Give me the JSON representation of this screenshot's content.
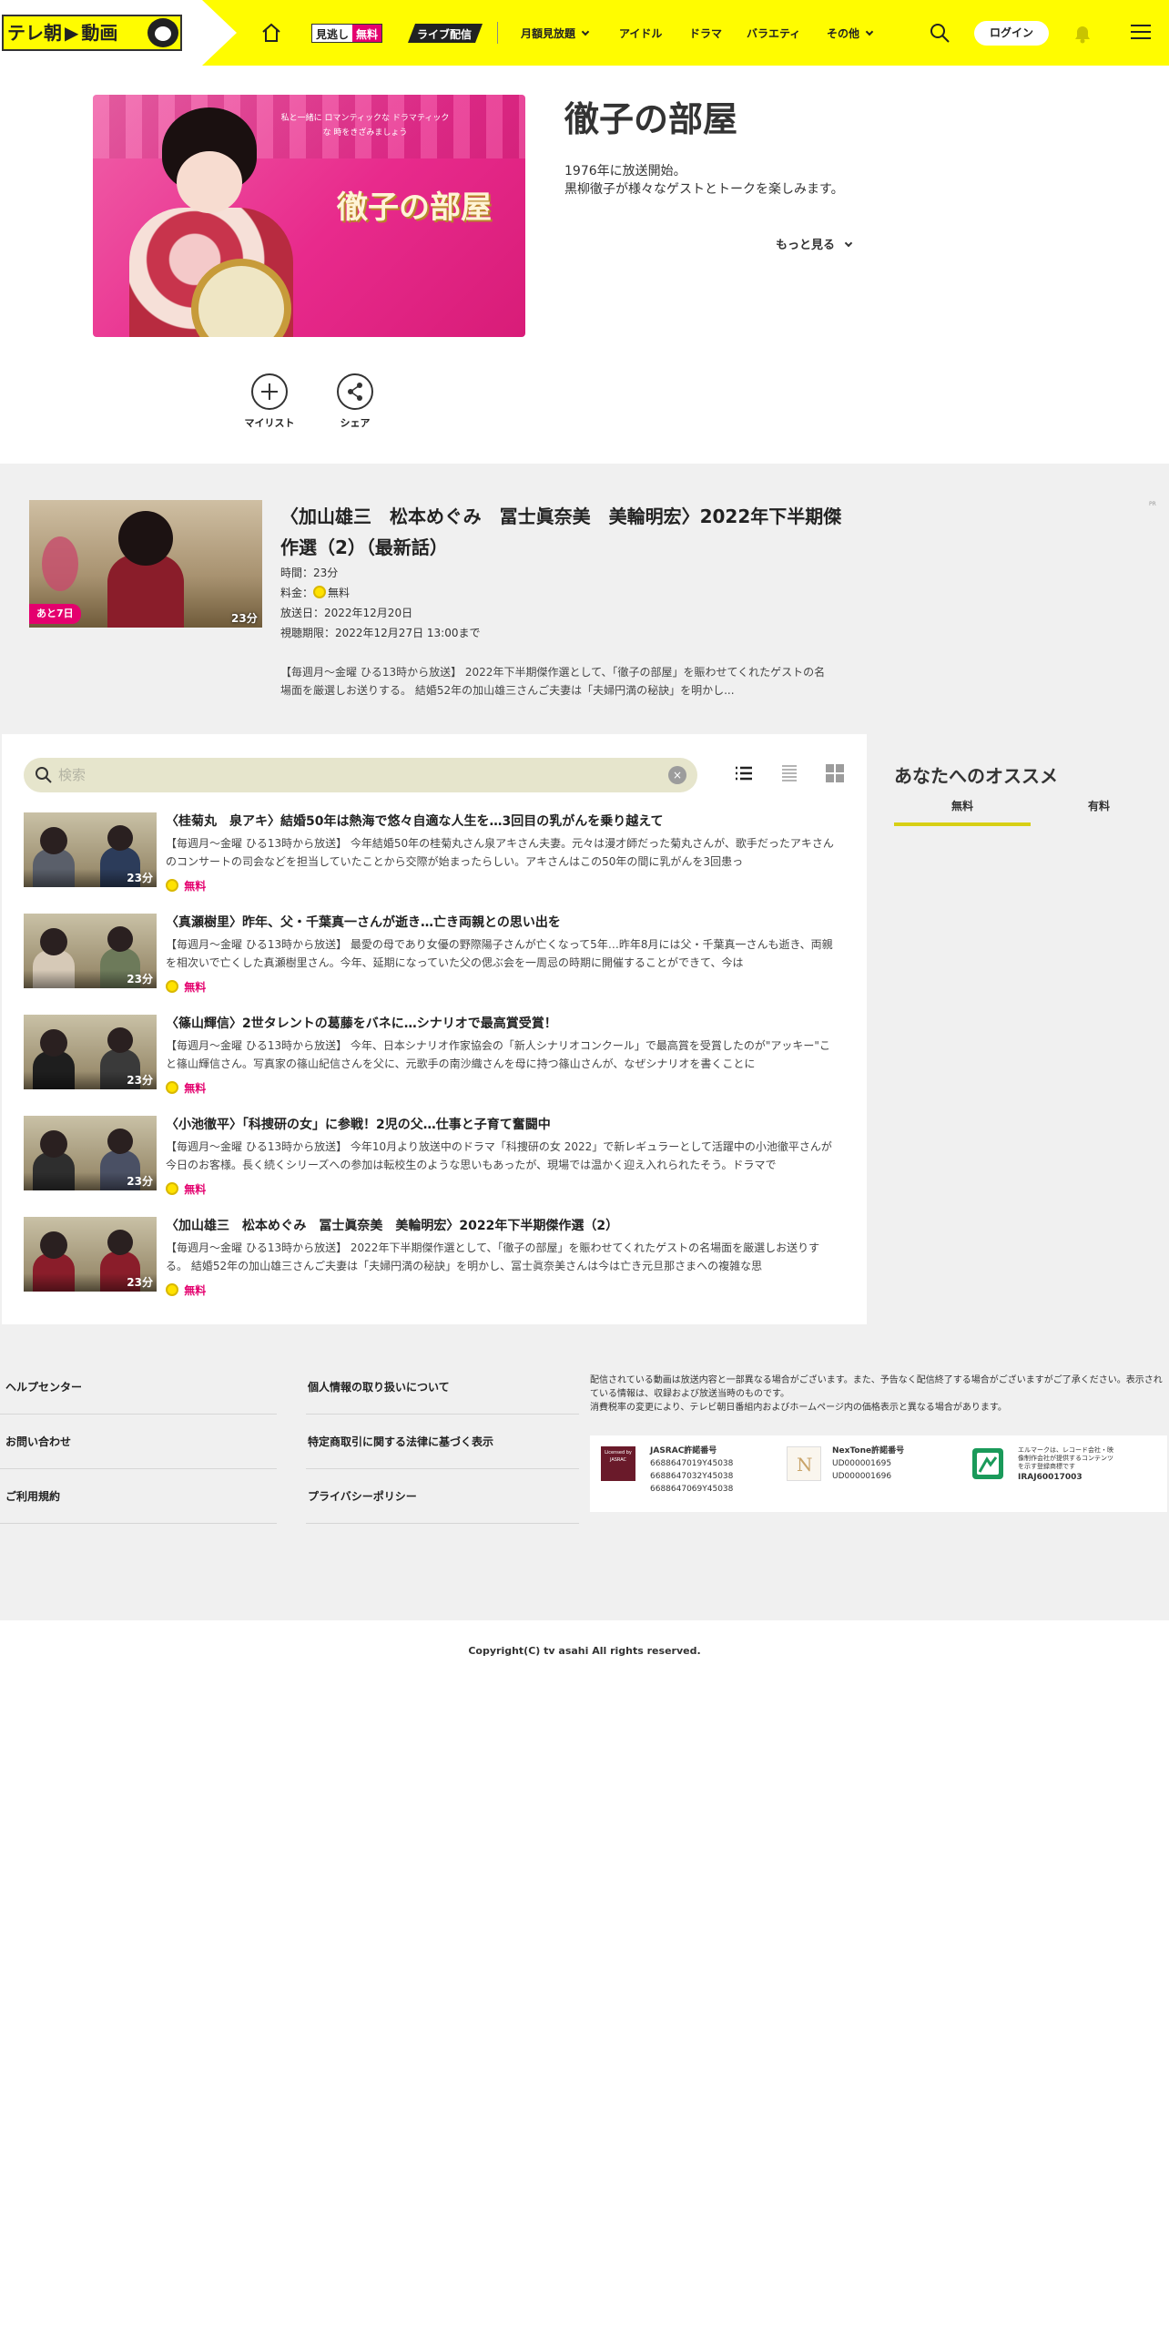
{
  "header": {
    "logo": "テレ朝",
    "logo_suffix": "動画",
    "nav_mino_a": "見逃し",
    "nav_mino_b": "無料",
    "nav_live": "ライブ配信",
    "nav_monthly": "月額見放題",
    "nav_idol": "アイドル",
    "nav_drama": "ドラマ",
    "nav_variety": "バラエティ",
    "nav_other": "その他",
    "login": "ログイン",
    "accent_color": "#fffc00"
  },
  "program": {
    "title": "徹子の部屋",
    "image_title": "徹子の部屋",
    "image_copy": "私と一緒に ロマンティックな ドラマティックな 時をきざみましょう",
    "desc_line1": "1976年に放送開始。",
    "desc_line2": "黒柳徹子が様々なゲストとトークを楽しみます。",
    "more": "もっと見る",
    "mylist": "マイリスト",
    "share": "シェア"
  },
  "latest": {
    "badge": "あと7日",
    "duration": "23分",
    "title": "〈加山雄三　松本めぐみ　冨士眞奈美　美輪明宏〉2022年下半期傑作選（2）（最新話）",
    "time": "時間：23分",
    "price_label": "料金：",
    "price_value": "無料",
    "aired": "放送日：2022年12月20日",
    "deadline": "視聴期限：2022年12月27日 13:00まで",
    "desc": "【毎週月～金曜 ひる13時から放送】 2022年下半期傑作選として、「徹子の部屋」を賑わせてくれたゲストの名場面を厳選しお送りする。 結婚52年の加山雄三さんご夫妻は「夫婦円満の秘訣」を明かし...",
    "pr": "PR"
  },
  "list": {
    "search_placeholder": "検索",
    "clear": "×",
    "episodes": [
      {
        "title": "〈桂菊丸　泉アキ〉結婚50年は熱海で悠々自適な人生を…3回目の乳がんを乗り越えて",
        "summary": "【毎週月～金曜 ひる13時から放送】 今年結婚50年の桂菊丸さん泉アキさん夫妻。元々は漫才師だった菊丸さんが、歌手だったアキさんのコンサートの司会などを担当していたことから交際が始まったらしい。アキさんはこの50年の間に乳がんを3回患っ",
        "duration": "23分",
        "price": "無料"
      },
      {
        "title": "〈真瀬樹里〉昨年、父・千葉真一さんが逝き…亡き両親との思い出を",
        "summary": "【毎週月～金曜 ひる13時から放送】 最愛の母であり女優の野際陽子さんが亡くなって5年…昨年8月には父・千葉真一さんも逝き、両親を相次いで亡くした真瀬樹里さん。今年、延期になっていた父の偲ぶ会を一周忌の時期に開催することができて、今は",
        "duration": "23分",
        "price": "無料"
      },
      {
        "title": "〈篠山輝信〉2世タレントの葛藤をバネに…シナリオで最高賞受賞！",
        "summary": "【毎週月～金曜 ひる13時から放送】 今年、日本シナリオ作家協会の「新人シナリオコンクール」で最高賞を受賞したのが\"アッキー\"こと篠山輝信さん。写真家の篠山紀信さんを父に、元歌手の南沙織さんを母に持つ篠山さんが、なぜシナリオを書くことに",
        "duration": "23分",
        "price": "無料"
      },
      {
        "title": "〈小池徹平〉「科捜研の女」に参戦！2児の父…仕事と子育て奮闘中",
        "summary": "【毎週月～金曜 ひる13時から放送】 今年10月より放送中のドラマ「科捜研の女 2022」で新レギュラーとして活躍中の小池徹平さんが今日のお客様。長く続くシリーズへの参加は転校生のような思いもあったが、現場では温かく迎え入れられたそう。ドラマで",
        "duration": "23分",
        "price": "無料"
      },
      {
        "title": "〈加山雄三　松本めぐみ　冨士眞奈美　美輪明宏〉2022年下半期傑作選（2）",
        "summary": "【毎週月～金曜 ひる13時から放送】 2022年下半期傑作選として、「徹子の部屋」を賑わせてくれたゲストの名場面を厳選しお送りする。 結婚52年の加山雄三さんご夫妻は「夫婦円満の秘訣」を明かし、冨士眞奈美さんは今は亡き元旦那さまへの複雑な思",
        "duration": "23分",
        "price": "無料"
      }
    ]
  },
  "recommend": {
    "title": "あなたへのオススメ",
    "tab_free": "無料",
    "tab_paid": "有料"
  },
  "footer": {
    "help": "ヘルプセンター",
    "contact": "お問い合わせ",
    "terms": "ご利用規約",
    "personal": "個人情報の取り扱いについて",
    "commerce": "特定商取引に関する法律に基づく表示",
    "privacy": "プライバシーポリシー",
    "note1": "配信されている動画は放送内容と一部異なる場合がございます。また、予告なく配信終了する場合がございますがご了承ください。表示されている情報は、収録および放送当時のものです。",
    "note2": "消費税率の変更により、テレビ朝日番組内およびホームページ内の価格表示と異なる場合があります。",
    "jasrac_logo": "Licensed by JASRAC",
    "jasrac_title": "JASRAC許諾番号",
    "jasrac_1": "6688647019Y45038",
    "jasrac_2": "6688647032Y45038",
    "jasrac_3": "6688647069Y45038",
    "nextone_title": "NexTone許諾番号",
    "nextone_1": "UD000001695",
    "nextone_2": "UD000001696",
    "elmark_text": "エルマークは、レコード会社・映像制作会社が提供するコンテンツを示す登録商標です",
    "elmark_no": "IRAJ60017003",
    "copyright": "Copyright(C) tv asahi All rights reserved."
  }
}
